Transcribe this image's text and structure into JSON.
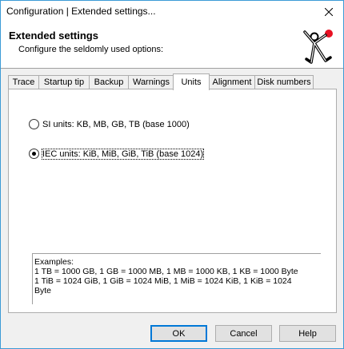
{
  "window": {
    "title": "Configuration | Extended settings...",
    "close_icon": "close-icon"
  },
  "header": {
    "title": "Extended settings",
    "subtitle": "Configure the seldomly used options:",
    "logo_icon": "running-man-logo-icon",
    "accent_color": "#e81123"
  },
  "tabs": [
    {
      "label": "Trace"
    },
    {
      "label": "Startup tip"
    },
    {
      "label": "Backup"
    },
    {
      "label": "Warnings"
    },
    {
      "label": "Units"
    },
    {
      "label": "Alignment"
    },
    {
      "label": "Disk numbers"
    }
  ],
  "active_tab": "Units",
  "units": {
    "si_label": "SI units: KB, MB, GB, TB  (base 1000)",
    "si_selected": false,
    "iec_label": "IEC units: KiB, MiB, GiB, TiB  (base 1024)",
    "iec_selected": true
  },
  "examples": {
    "heading": "Examples:",
    "line1": "1 TB = 1000 GB, 1 GB = 1000 MB, 1 MB = 1000 KB, 1 KB = 1000 Byte",
    "line2": "1 TiB = 1024 GiB, 1 GiB = 1024 MiB, 1 MiB = 1024 KiB, 1 KiB = 1024",
    "line3": "Byte"
  },
  "buttons": {
    "ok": "OK",
    "cancel": "Cancel",
    "help": "Help"
  }
}
